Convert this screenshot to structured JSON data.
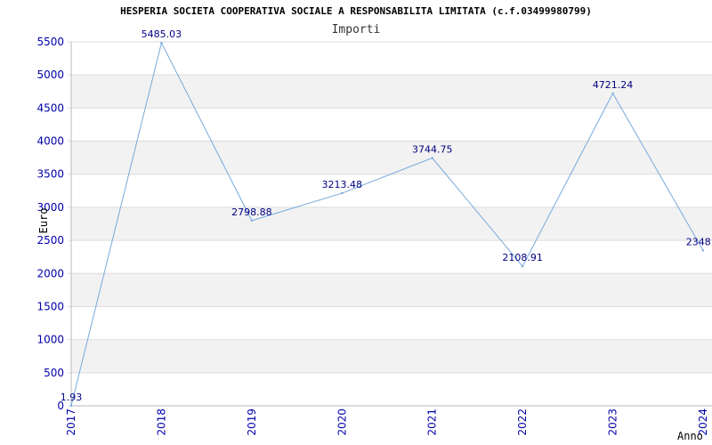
{
  "chart_data": {
    "type": "line",
    "title": "HESPERIA SOCIETA COOPERATIVA SOCIALE A RESPONSABILITA LIMITATA (c.f.03499980799)",
    "subtitle": "Importi",
    "xlabel": "Anno",
    "ylabel": "Euro",
    "x": [
      "2017",
      "2018",
      "2019",
      "2020",
      "2021",
      "2022",
      "2023",
      "2024"
    ],
    "series": [
      {
        "values": [
          1.93,
          5485.03,
          2798.88,
          3213.48,
          3744.75,
          2108.91,
          4721.24,
          2348.0
        ],
        "labels": [
          "1.93",
          "5485.03",
          "2798.88",
          "3213.48",
          "3744.75",
          "2108.91",
          "4721.24",
          "2348.0"
        ]
      }
    ],
    "yticks": [
      0,
      500,
      1000,
      1500,
      2000,
      2500,
      3000,
      3500,
      4000,
      4500,
      5000,
      5500
    ],
    "ylim": [
      0,
      5500
    ],
    "grid": true,
    "colors": {
      "line": "#77aadd",
      "band": "#f2f2f2",
      "gridline": "#dddddd",
      "tick_text": "#0000aa",
      "label_text": "#000080"
    }
  }
}
